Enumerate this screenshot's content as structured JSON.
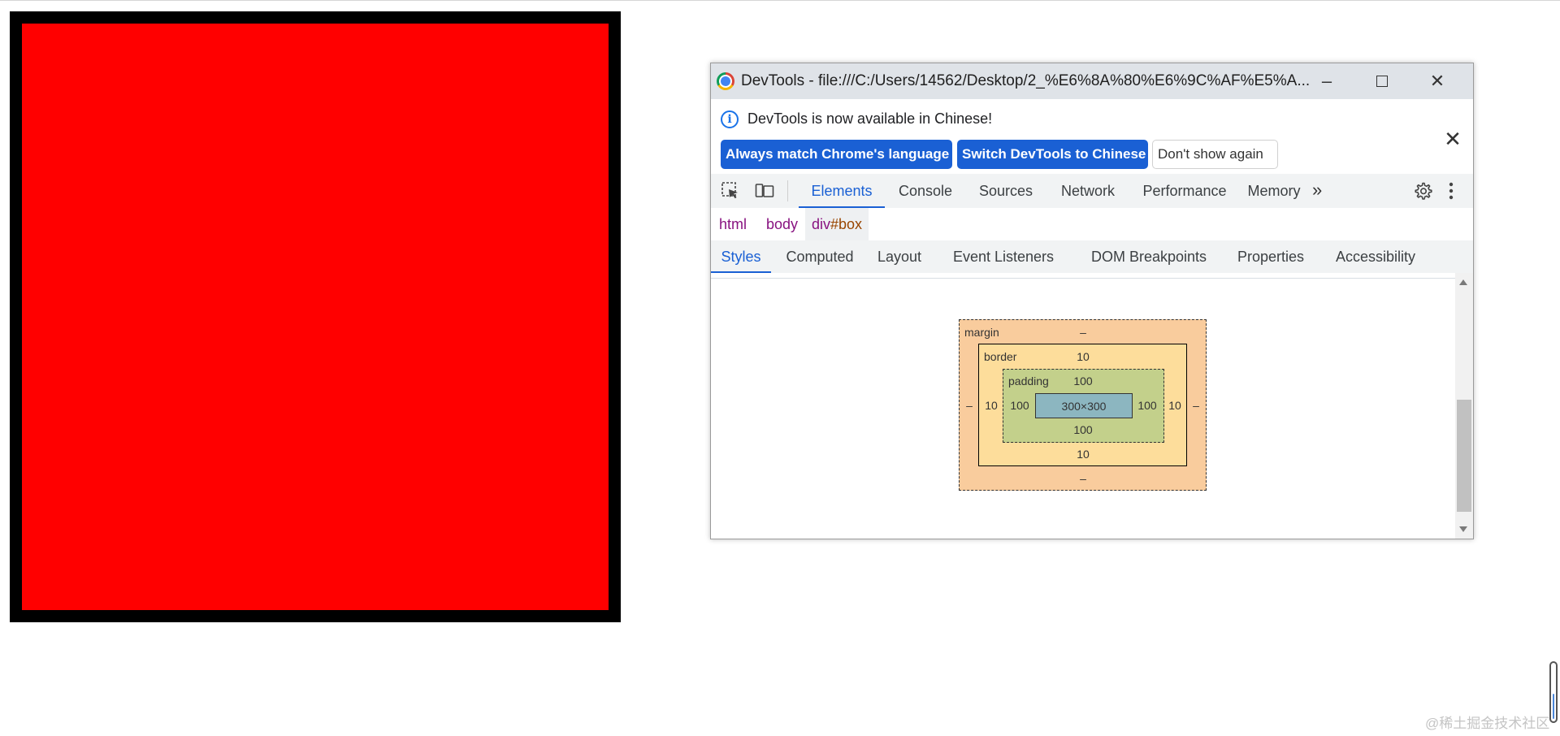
{
  "page": {
    "box_border_color": "#000000",
    "box_fill_color": "#ff0000",
    "watermark": "@稀土掘金技术社区"
  },
  "devtools": {
    "title": "DevTools - file:///C:/Users/14562/Desktop/2_%E6%8A%80%E6%9C%AF%E5%A...",
    "window_controls": {
      "minimize": "–",
      "close": "✕"
    },
    "infobar": {
      "message": "DevTools is now available in Chinese!",
      "buttons": {
        "always_match": "Always match Chrome's language",
        "switch": "Switch DevTools to Chinese",
        "dont_show": "Don't show again"
      },
      "close": "✕"
    },
    "main_tabs": [
      "Elements",
      "Console",
      "Sources",
      "Network",
      "Performance",
      "Memory"
    ],
    "active_main_tab": "Elements",
    "more_tabs": "»",
    "breadcrumbs": {
      "html": "html",
      "body": "body",
      "current_tag": "div",
      "current_id": "#box"
    },
    "sub_tabs": [
      "Styles",
      "Computed",
      "Layout",
      "Event Listeners",
      "DOM Breakpoints",
      "Properties",
      "Accessibility"
    ],
    "active_sub_tab": "Styles",
    "box_model": {
      "margin_label": "margin",
      "border_label": "border",
      "padding_label": "padding",
      "margin": {
        "top": "–",
        "right": "–",
        "bottom": "–",
        "left": "–"
      },
      "border": {
        "top": "10",
        "right": "10",
        "bottom": "10",
        "left": "10"
      },
      "padding": {
        "top": "100",
        "right": "100",
        "bottom": "100",
        "left": "100"
      },
      "content": "300×300",
      "colors": {
        "margin": "#f9cc9d",
        "border": "#fddd9b",
        "padding": "#c3d08b",
        "content": "#8cb6c0"
      }
    },
    "accent_color": "#1a60d4"
  }
}
